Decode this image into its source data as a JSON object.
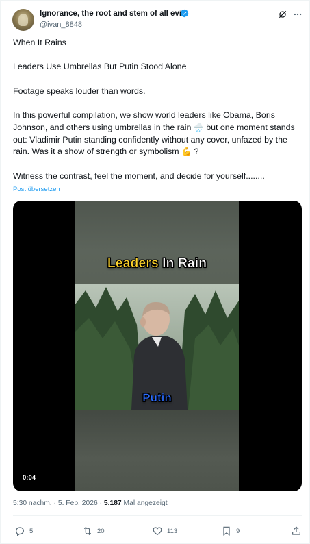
{
  "author": {
    "display_name": "Ignorance, the root and stem of all evil",
    "handle": "@ivan_8848",
    "verified_color": "#1d9bf0"
  },
  "header_icons": [
    "grok-icon",
    "more-icon"
  ],
  "tweet": {
    "paragraphs": [
      "When It Rains",
      "Leaders Use Umbrellas But Putin Stood Alone",
      "Footage speaks louder than words.",
      "In this powerful compilation, we show world leaders like Obama, Boris Johnson, and others using umbrellas in the rain",
      "but one moment stands out: Vladimir Putin standing confidently without any cover, unfazed by the rain. Was it a show of strength or symbolism",
      "?",
      "Witness the contrast, feel the moment, and decide for yourself........"
    ],
    "emoji_rain": "🌧️",
    "emoji_flex": "💪",
    "translate_link": "Post übersetzen"
  },
  "video": {
    "caption_top_word1": "Leaders",
    "caption_top_word2": "In Rain",
    "caption_bottom": "Putin",
    "elapsed": "0:04",
    "caption_colors": {
      "yellow": "#ffd42a",
      "white": "#ffffff",
      "blue": "#2b6cff"
    }
  },
  "meta": {
    "time": "5:30 nachm.",
    "separator": "·",
    "date": "5. Feb. 2026",
    "views": "5.187",
    "views_label": "Mal angezeigt"
  },
  "actions": {
    "reply_count": "5",
    "retweet_count": "20",
    "like_count": "113",
    "bookmark_count": "9"
  }
}
